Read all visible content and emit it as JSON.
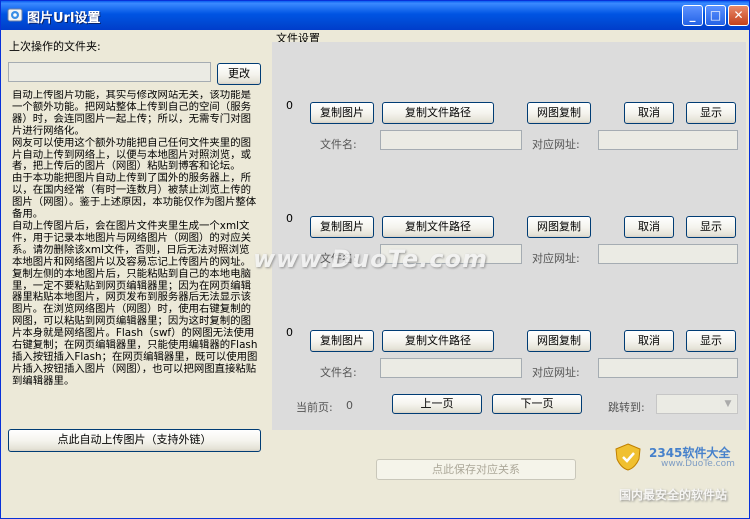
{
  "window": {
    "title": "图片Url设置",
    "min_label": "_",
    "max_label": "□",
    "close_label": "✕"
  },
  "left": {
    "last_folder_label": "上次操作的文件夹:",
    "last_folder_value": "",
    "change_button": "更改",
    "help_text": "自动上传图片功能，其实与修改网站无关，该功能是一个额外功能。把网站整体上传到自己的空间（服务器）时，会连同图片一起上传；所以，无需专门对图片进行网络化。\n网友可以使用这个额外功能把自己任何文件夹里的图片自动上传到网络上，以便与本地图片对照浏览，或者，把上传后的图片（网图）粘贴到博客和论坛。\n由于本功能把图片自动上传到了国外的服务器上，所以，在国内经常（有时一连数月）被禁止浏览上传的图片（网图）。鉴于上述原因，本功能仅作为图片整体备用。\n自动上传图片后，会在图片文件夹里生成一个xml文件，用于记录本地图片与网络图片（网图）的对应关系。请勿删除该xml文件，否则，日后无法对照浏览本地图片和网络图片以及容易忘记上传图片的网址。\n复制左侧的本地图片后，只能粘贴到自己的本地电脑里，一定不要粘贴到网页编辑器里；因为在网页编辑器里粘贴本地图片，网页发布到服务器后无法显示该图片。在浏览网络图片（网图）时，使用右键复制的网图，可以粘贴到网页编辑器里；因为这时复制的图片本身就是网络图片。Flash（swf）的网图无法使用右键复制；在网页编辑器里，只能使用编辑器的Flash插入按钮插入Flash；在网页编辑器里，既可以使用图片插入按钮插入图片（网图），也可以把网图直接粘贴到编辑器里。",
    "upload_button": "点此自动上传图片（支持外链）"
  },
  "right": {
    "group_title": "文件设置",
    "rows": [
      {
        "index": "0",
        "copy_image": "复制图片",
        "copy_path": "复制文件路径",
        "copy_web": "网图复制",
        "cancel": "取消",
        "show": "显示",
        "filename_label": "文件名:",
        "url_label": "对应网址:"
      },
      {
        "index": "0",
        "copy_image": "复制图片",
        "copy_path": "复制文件路径",
        "copy_web": "网图复制",
        "cancel": "取消",
        "show": "显示",
        "filename_label": "文件名:",
        "url_label": "对应网址:"
      },
      {
        "index": "0",
        "copy_image": "复制图片",
        "copy_path": "复制文件路径",
        "copy_web": "网图复制",
        "cancel": "取消",
        "show": "显示",
        "filename_label": "文件名:",
        "url_label": "对应网址:"
      }
    ],
    "pager": {
      "current_label": "当前页:",
      "current_value": "0",
      "prev": "上一页",
      "next": "下一页",
      "jump_label": "跳转到:"
    },
    "save_button": "点此保存对应关系"
  },
  "watermarks": {
    "center": "www.DuoTe.com",
    "corner_brand": "2345软件大全",
    "corner_url": "www.DuoTe.com",
    "corner_slogan": "国内最安全的软件站"
  }
}
